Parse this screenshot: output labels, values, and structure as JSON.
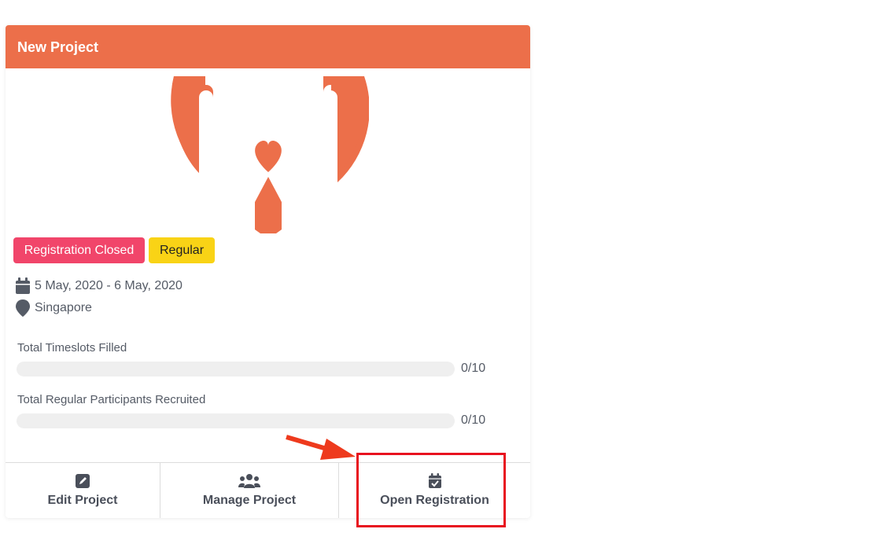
{
  "card": {
    "title": "New Project",
    "header_color": "#ec6f4a",
    "logo_icon": "hands-heart-logo-icon"
  },
  "badges": {
    "status": "Registration Closed",
    "type": "Regular"
  },
  "info": {
    "date_range": "5 May, 2020 - 6 May, 2020",
    "location": "Singapore"
  },
  "progress": [
    {
      "label": "Total Timeslots Filled",
      "value_text": "0/10",
      "fraction": 0
    },
    {
      "label": "Total Regular Participants Recruited",
      "value_text": "0/10",
      "fraction": 0
    }
  ],
  "actions": {
    "edit": {
      "label": "Edit Project",
      "icon": "edit-icon"
    },
    "manage": {
      "label": "Manage Project",
      "icon": "users-icon"
    },
    "open": {
      "label": "Open Registration",
      "icon": "calendar-check-icon"
    }
  },
  "annotation": {
    "highlight_color": "#e8121f",
    "arrow_color": "#ee3a1d"
  }
}
